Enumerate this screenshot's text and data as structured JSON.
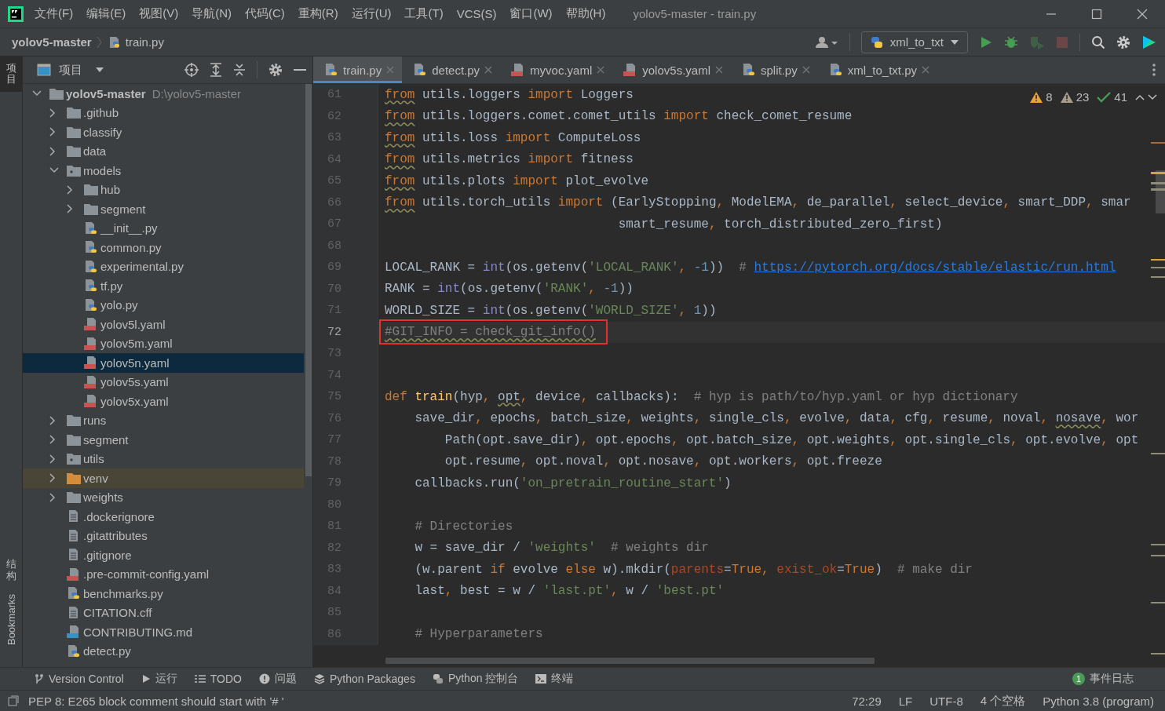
{
  "window": {
    "title": "yolov5-master - train.py"
  },
  "menu": [
    "文件(F)",
    "编辑(E)",
    "视图(V)",
    "导航(N)",
    "代码(C)",
    "重构(R)",
    "运行(U)",
    "工具(T)",
    "VCS(S)",
    "窗口(W)",
    "帮助(H)"
  ],
  "breadcrumb": {
    "project": "yolov5-master",
    "file": "train.py"
  },
  "run_config": {
    "label": "xml_to_txt"
  },
  "toolbar": [
    {
      "kind": "run",
      "disabled": false
    },
    {
      "kind": "debug",
      "disabled": false
    },
    {
      "kind": "coverage",
      "disabled": true
    },
    {
      "kind": "stop",
      "disabled": true
    }
  ],
  "side_tabs": [
    {
      "label": "项目",
      "kind": "cjk",
      "selected": true
    },
    {
      "label": "结构",
      "kind": "cjk",
      "selected": false
    },
    {
      "label": "Bookmarks",
      "kind": "latin",
      "selected": false
    }
  ],
  "project": {
    "title": "项目",
    "tree": [
      {
        "name": "yolov5-master",
        "hint": "D:\\yolov5-master",
        "kind": "folder",
        "expanded": true,
        "selected": false,
        "children": [
          {
            "name": ".github",
            "kind": "folder",
            "expanded": false,
            "selected": false
          },
          {
            "name": "classify",
            "kind": "folder",
            "expanded": false,
            "selected": false
          },
          {
            "name": "data",
            "kind": "folder",
            "expanded": false,
            "selected": false
          },
          {
            "name": "models",
            "kind": "package",
            "expanded": true,
            "selected": false,
            "children": [
              {
                "name": "hub",
                "kind": "folder",
                "expanded": false,
                "selected": false
              },
              {
                "name": "segment",
                "kind": "folder",
                "expanded": false,
                "selected": false
              },
              {
                "name": "__init__.py",
                "kind": "py",
                "selected": false
              },
              {
                "name": "common.py",
                "kind": "py",
                "selected": false
              },
              {
                "name": "experimental.py",
                "kind": "py",
                "selected": false
              },
              {
                "name": "tf.py",
                "kind": "py",
                "selected": false
              },
              {
                "name": "yolo.py",
                "kind": "py",
                "selected": false
              },
              {
                "name": "yolov5l.yaml",
                "kind": "yaml",
                "selected": false
              },
              {
                "name": "yolov5m.yaml",
                "kind": "yaml",
                "selected": false
              },
              {
                "name": "yolov5n.yaml",
                "kind": "yaml",
                "selected": true
              },
              {
                "name": "yolov5s.yaml",
                "kind": "yaml",
                "selected": false
              },
              {
                "name": "yolov5x.yaml",
                "kind": "yaml",
                "selected": false
              }
            ]
          },
          {
            "name": "runs",
            "kind": "folder",
            "expanded": false,
            "selected": false
          },
          {
            "name": "segment",
            "kind": "folder",
            "expanded": false,
            "selected": false
          },
          {
            "name": "utils",
            "kind": "package",
            "expanded": false,
            "selected": false
          },
          {
            "name": "venv",
            "kind": "excluded",
            "expanded": false,
            "selected": false
          },
          {
            "name": "weights",
            "kind": "folder",
            "expanded": false,
            "selected": false
          },
          {
            "name": ".dockerignore",
            "kind": "file",
            "selected": false
          },
          {
            "name": ".gitattributes",
            "kind": "file",
            "selected": false
          },
          {
            "name": ".gitignore",
            "kind": "file",
            "selected": false
          },
          {
            "name": ".pre-commit-config.yaml",
            "kind": "yaml",
            "selected": false
          },
          {
            "name": "benchmarks.py",
            "kind": "py",
            "selected": false
          },
          {
            "name": "CITATION.cff",
            "kind": "file",
            "selected": false
          },
          {
            "name": "CONTRIBUTING.md",
            "kind": "md",
            "selected": false
          },
          {
            "name": "detect.py",
            "kind": "py",
            "selected": false
          }
        ]
      }
    ]
  },
  "tabs": [
    {
      "label": "train.py",
      "kind": "py",
      "selected": true
    },
    {
      "label": "detect.py",
      "kind": "py",
      "selected": false
    },
    {
      "label": "myvoc.yaml",
      "kind": "yaml",
      "selected": false
    },
    {
      "label": "yolov5s.yaml",
      "kind": "yaml",
      "selected": false
    },
    {
      "label": "split.py",
      "kind": "py",
      "selected": false
    },
    {
      "label": "xml_to_txt.py",
      "kind": "py",
      "selected": false
    }
  ],
  "inspections": {
    "warnings": "8",
    "weak_warnings": "23",
    "typos": "41"
  },
  "code": [
    {
      "number": "61",
      "current": false,
      "boxed": false,
      "tokens": [
        {
          "text": "from",
          "kind": "kw-sq"
        },
        {
          "text": " utils.loggers ",
          "kind": "text"
        },
        {
          "text": "import",
          "kind": "kw"
        },
        {
          "text": " Loggers",
          "kind": "text"
        }
      ]
    },
    {
      "number": "62",
      "current": false,
      "boxed": false,
      "tokens": [
        {
          "text": "from",
          "kind": "kw-sq"
        },
        {
          "text": " utils.loggers.comet.comet_utils ",
          "kind": "text"
        },
        {
          "text": "import",
          "kind": "kw"
        },
        {
          "text": " check_comet_resume",
          "kind": "text"
        }
      ]
    },
    {
      "number": "63",
      "current": false,
      "boxed": false,
      "tokens": [
        {
          "text": "from",
          "kind": "kw-sq"
        },
        {
          "text": " utils.loss ",
          "kind": "text"
        },
        {
          "text": "import",
          "kind": "kw"
        },
        {
          "text": " ComputeLoss",
          "kind": "text"
        }
      ]
    },
    {
      "number": "64",
      "current": false,
      "boxed": false,
      "tokens": [
        {
          "text": "from",
          "kind": "kw-sq"
        },
        {
          "text": " utils.metrics ",
          "kind": "text"
        },
        {
          "text": "import",
          "kind": "kw"
        },
        {
          "text": " fitness",
          "kind": "text"
        }
      ]
    },
    {
      "number": "65",
      "current": false,
      "boxed": false,
      "tokens": [
        {
          "text": "from",
          "kind": "kw-sq"
        },
        {
          "text": " utils.plots ",
          "kind": "text"
        },
        {
          "text": "import",
          "kind": "kw"
        },
        {
          "text": " plot_evolve",
          "kind": "text"
        }
      ]
    },
    {
      "number": "66",
      "current": false,
      "boxed": false,
      "tokens": [
        {
          "text": "from",
          "kind": "kw-sq"
        },
        {
          "text": " utils.torch_utils ",
          "kind": "text"
        },
        {
          "text": "import",
          "kind": "kw"
        },
        {
          "text": " (EarlyStopping",
          "kind": "text"
        },
        {
          "text": ",",
          "kind": "kw"
        },
        {
          "text": " ModelEMA",
          "kind": "text"
        },
        {
          "text": ",",
          "kind": "kw"
        },
        {
          "text": " de_parallel",
          "kind": "text"
        },
        {
          "text": ",",
          "kind": "kw"
        },
        {
          "text": " select_device",
          "kind": "text"
        },
        {
          "text": ",",
          "kind": "kw"
        },
        {
          "text": " smart_DDP",
          "kind": "text"
        },
        {
          "text": ",",
          "kind": "kw"
        },
        {
          "text": " smar",
          "kind": "text"
        }
      ]
    },
    {
      "number": "67",
      "current": false,
      "boxed": false,
      "tokens": [
        {
          "text": "                               smart_resume",
          "kind": "text"
        },
        {
          "text": ",",
          "kind": "kw"
        },
        {
          "text": " torch_distributed_zero_first)",
          "kind": "text"
        }
      ]
    },
    {
      "number": "68",
      "current": false,
      "boxed": false
    },
    {
      "number": "69",
      "current": false,
      "boxed": false,
      "tokens": [
        {
          "text": "LOCAL_RANK = ",
          "kind": "text"
        },
        {
          "text": "int",
          "kind": "builtin"
        },
        {
          "text": "(os.getenv(",
          "kind": "text"
        },
        {
          "text": "'LOCAL_RANK'",
          "kind": "str"
        },
        {
          "text": ",",
          "kind": "kw"
        },
        {
          "text": " -1",
          "kind": "num"
        },
        {
          "text": "))",
          "kind": "text"
        },
        {
          "text": "  # ",
          "kind": "comment"
        },
        {
          "text": "https://pytorch.org/docs/stable/elastic/run.html",
          "kind": "link"
        }
      ]
    },
    {
      "number": "70",
      "current": false,
      "boxed": false,
      "tokens": [
        {
          "text": "RANK = ",
          "kind": "text"
        },
        {
          "text": "int",
          "kind": "builtin"
        },
        {
          "text": "(os.getenv(",
          "kind": "text"
        },
        {
          "text": "'RANK'",
          "kind": "str"
        },
        {
          "text": ",",
          "kind": "kw"
        },
        {
          "text": " -1",
          "kind": "num"
        },
        {
          "text": "))",
          "kind": "text"
        }
      ]
    },
    {
      "number": "71",
      "current": false,
      "boxed": false,
      "tokens": [
        {
          "text": "WORLD_SIZE = ",
          "kind": "text"
        },
        {
          "text": "int",
          "kind": "builtin"
        },
        {
          "text": "(os.getenv(",
          "kind": "text"
        },
        {
          "text": "'WORLD_SIZE'",
          "kind": "str"
        },
        {
          "text": ",",
          "kind": "kw"
        },
        {
          "text": " 1",
          "kind": "num"
        },
        {
          "text": "))",
          "kind": "text"
        }
      ]
    },
    {
      "number": "72",
      "current": true,
      "boxed": true,
      "tokens": [
        {
          "text": "#GIT_INFO = check_git_info()",
          "kind": "comment-sq"
        }
      ]
    },
    {
      "number": "73",
      "current": false,
      "boxed": false
    },
    {
      "number": "74",
      "current": false,
      "boxed": false
    },
    {
      "number": "75",
      "current": false,
      "boxed": false,
      "tokens": [
        {
          "text": "def",
          "kind": "kw"
        },
        {
          "text": " train",
          "kind": "fn"
        },
        {
          "text": "(hyp",
          "kind": "text"
        },
        {
          "text": ",",
          "kind": "kw"
        },
        {
          "text": "opt",
          "kind": "text-sq"
        },
        {
          "text": ",",
          "kind": "kw"
        },
        {
          "text": " device",
          "kind": "text"
        },
        {
          "text": ",",
          "kind": "kw"
        },
        {
          "text": " callbacks):",
          "kind": "text"
        },
        {
          "text": "  # hyp is path/to/hyp.yaml or hyp dictionary",
          "kind": "comment"
        }
      ]
    },
    {
      "number": "76",
      "current": false,
      "boxed": false,
      "tokens": [
        {
          "text": "    save_dir",
          "kind": "text"
        },
        {
          "text": ",",
          "kind": "kw"
        },
        {
          "text": " epochs",
          "kind": "text"
        },
        {
          "text": ",",
          "kind": "kw"
        },
        {
          "text": " batch_size",
          "kind": "text"
        },
        {
          "text": ",",
          "kind": "kw"
        },
        {
          "text": " weights",
          "kind": "text"
        },
        {
          "text": ",",
          "kind": "kw"
        },
        {
          "text": " single_cls",
          "kind": "text"
        },
        {
          "text": ",",
          "kind": "kw"
        },
        {
          "text": " evolve",
          "kind": "text"
        },
        {
          "text": ",",
          "kind": "kw"
        },
        {
          "text": " data",
          "kind": "text"
        },
        {
          "text": ",",
          "kind": "kw"
        },
        {
          "text": " cfg",
          "kind": "text"
        },
        {
          "text": ",",
          "kind": "kw"
        },
        {
          "text": " resume",
          "kind": "text"
        },
        {
          "text": ",",
          "kind": "kw"
        },
        {
          "text": " noval",
          "kind": "text"
        },
        {
          "text": ",",
          "kind": "kw"
        },
        {
          "text": "nosave",
          "kind": "text-sq"
        },
        {
          "text": ",",
          "kind": "kw"
        },
        {
          "text": " wor",
          "kind": "text"
        }
      ]
    },
    {
      "number": "77",
      "current": false,
      "boxed": false,
      "tokens": [
        {
          "text": "        Path(opt.save_dir)",
          "kind": "text"
        },
        {
          "text": ",",
          "kind": "kw"
        },
        {
          "text": " opt.epochs",
          "kind": "text"
        },
        {
          "text": ",",
          "kind": "kw"
        },
        {
          "text": " opt.batch_size",
          "kind": "text"
        },
        {
          "text": ",",
          "kind": "kw"
        },
        {
          "text": " opt.weights",
          "kind": "text"
        },
        {
          "text": ",",
          "kind": "kw"
        },
        {
          "text": " opt.single_cls",
          "kind": "text"
        },
        {
          "text": ",",
          "kind": "kw"
        },
        {
          "text": " opt.evolve",
          "kind": "text"
        },
        {
          "text": ",",
          "kind": "kw"
        },
        {
          "text": " opt",
          "kind": "text"
        }
      ]
    },
    {
      "number": "78",
      "current": false,
      "boxed": false,
      "tokens": [
        {
          "text": "        opt.resume",
          "kind": "text"
        },
        {
          "text": ",",
          "kind": "kw"
        },
        {
          "text": " opt.noval",
          "kind": "text"
        },
        {
          "text": ",",
          "kind": "kw"
        },
        {
          "text": " opt.nosave",
          "kind": "text"
        },
        {
          "text": ",",
          "kind": "kw"
        },
        {
          "text": " opt.workers",
          "kind": "text"
        },
        {
          "text": ",",
          "kind": "kw"
        },
        {
          "text": " opt.freeze",
          "kind": "text"
        }
      ]
    },
    {
      "number": "79",
      "current": false,
      "boxed": false,
      "tokens": [
        {
          "text": "    callbacks.run(",
          "kind": "text"
        },
        {
          "text": "'on_pretrain_routine_start'",
          "kind": "str"
        },
        {
          "text": ")",
          "kind": "text"
        }
      ]
    },
    {
      "number": "80",
      "current": false,
      "boxed": false
    },
    {
      "number": "81",
      "current": false,
      "boxed": false,
      "tokens": [
        {
          "text": "    # Directories",
          "kind": "comment"
        }
      ]
    },
    {
      "number": "82",
      "current": false,
      "boxed": false,
      "tokens": [
        {
          "text": "    w = save_dir / ",
          "kind": "text"
        },
        {
          "text": "'weights'",
          "kind": "str"
        },
        {
          "text": "  # weights dir",
          "kind": "comment"
        }
      ]
    },
    {
      "number": "83",
      "current": false,
      "boxed": false,
      "tokens": [
        {
          "text": "    (w.parent ",
          "kind": "text"
        },
        {
          "text": "if",
          "kind": "kw"
        },
        {
          "text": " evolve ",
          "kind": "text"
        },
        {
          "text": "else",
          "kind": "kw"
        },
        {
          "text": " w).mkdir(",
          "kind": "text"
        },
        {
          "text": "parents",
          "kind": "param"
        },
        {
          "text": "=",
          "kind": "text"
        },
        {
          "text": "True",
          "kind": "kw"
        },
        {
          "text": ",",
          "kind": "kw"
        },
        {
          "text": " exist_ok",
          "kind": "param"
        },
        {
          "text": "=",
          "kind": "text"
        },
        {
          "text": "True",
          "kind": "kw"
        },
        {
          "text": ")",
          "kind": "text"
        },
        {
          "text": "  # make dir",
          "kind": "comment"
        }
      ]
    },
    {
      "number": "84",
      "current": false,
      "boxed": false,
      "tokens": [
        {
          "text": "    last",
          "kind": "text"
        },
        {
          "text": ",",
          "kind": "kw"
        },
        {
          "text": " best = w / ",
          "kind": "text"
        },
        {
          "text": "'last.pt'",
          "kind": "str"
        },
        {
          "text": ",",
          "kind": "kw"
        },
        {
          "text": " w / ",
          "kind": "text"
        },
        {
          "text": "'best.pt'",
          "kind": "str"
        }
      ]
    },
    {
      "number": "85",
      "current": false,
      "boxed": false
    },
    {
      "number": "86",
      "current": false,
      "boxed": false,
      "tokens": [
        {
          "text": "    # Hyperparameters",
          "kind": "comment"
        }
      ]
    }
  ],
  "tool_windows": [
    {
      "label": "Version Control",
      "kind": "vcs"
    },
    {
      "label": "运行",
      "kind": "run"
    },
    {
      "label": "TODO",
      "kind": "todo"
    },
    {
      "label": "问题",
      "kind": "problems"
    },
    {
      "label": "Python Packages",
      "kind": "packages"
    },
    {
      "label": "Python 控制台",
      "kind": "console"
    },
    {
      "label": "终端",
      "kind": "terminal"
    }
  ],
  "event_log": {
    "count": "1",
    "label": "事件日志"
  },
  "status_bar": {
    "message": "PEP 8: E265 block comment should start with '# '",
    "items": [
      "72:29",
      "LF",
      "UTF-8",
      "4 个空格",
      "Python 3.8 (program)"
    ]
  }
}
